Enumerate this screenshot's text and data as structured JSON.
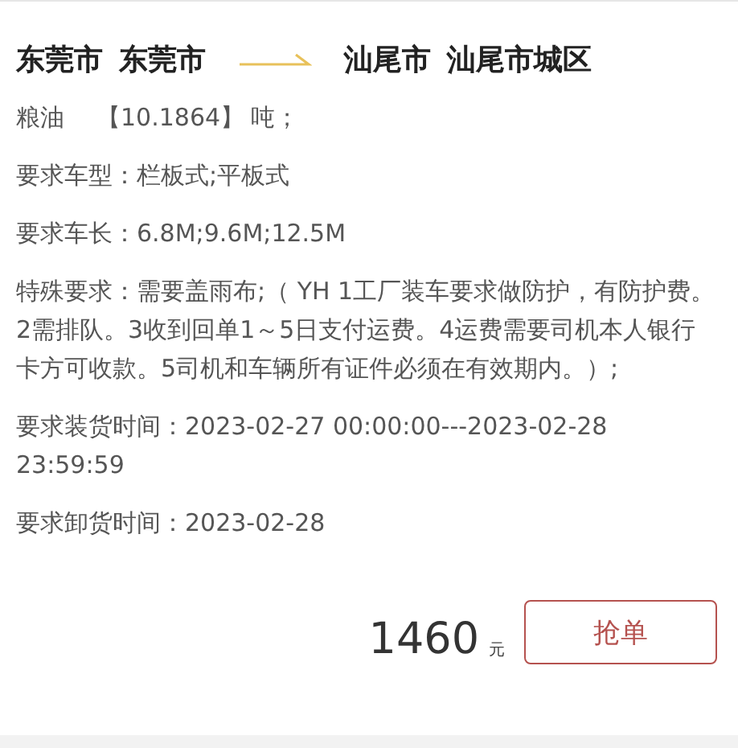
{
  "route": {
    "origin_city": "东莞市",
    "origin_district": "东莞市",
    "destination_city": "汕尾市",
    "destination_district": "汕尾市城区"
  },
  "cargo": {
    "name": "粮油",
    "quantity": "【10.1864】",
    "unit": "吨；"
  },
  "details": [
    {
      "label": "要求车型：",
      "value": "栏板式;平板式"
    },
    {
      "label": "要求车长：",
      "value": "6.8M;9.6M;12.5M"
    },
    {
      "label": "特殊要求：",
      "value": "需要盖雨布;（ YH 1工厂装车要求做防护，有防护费。2需排队。3收到回单1～5日支付运费。4运费需要司机本人银行卡方可收款。5司机和车辆所有证件必须在有效期内。）;"
    },
    {
      "label": "要求装货时间：",
      "value": "2023-02-27 00:00:00---2023-02-28 23:59:59"
    },
    {
      "label": "要求卸货时间：",
      "value": "2023-02-28"
    }
  ],
  "price": {
    "amount": "1460",
    "currency": "元"
  },
  "grab_button": "抢单"
}
